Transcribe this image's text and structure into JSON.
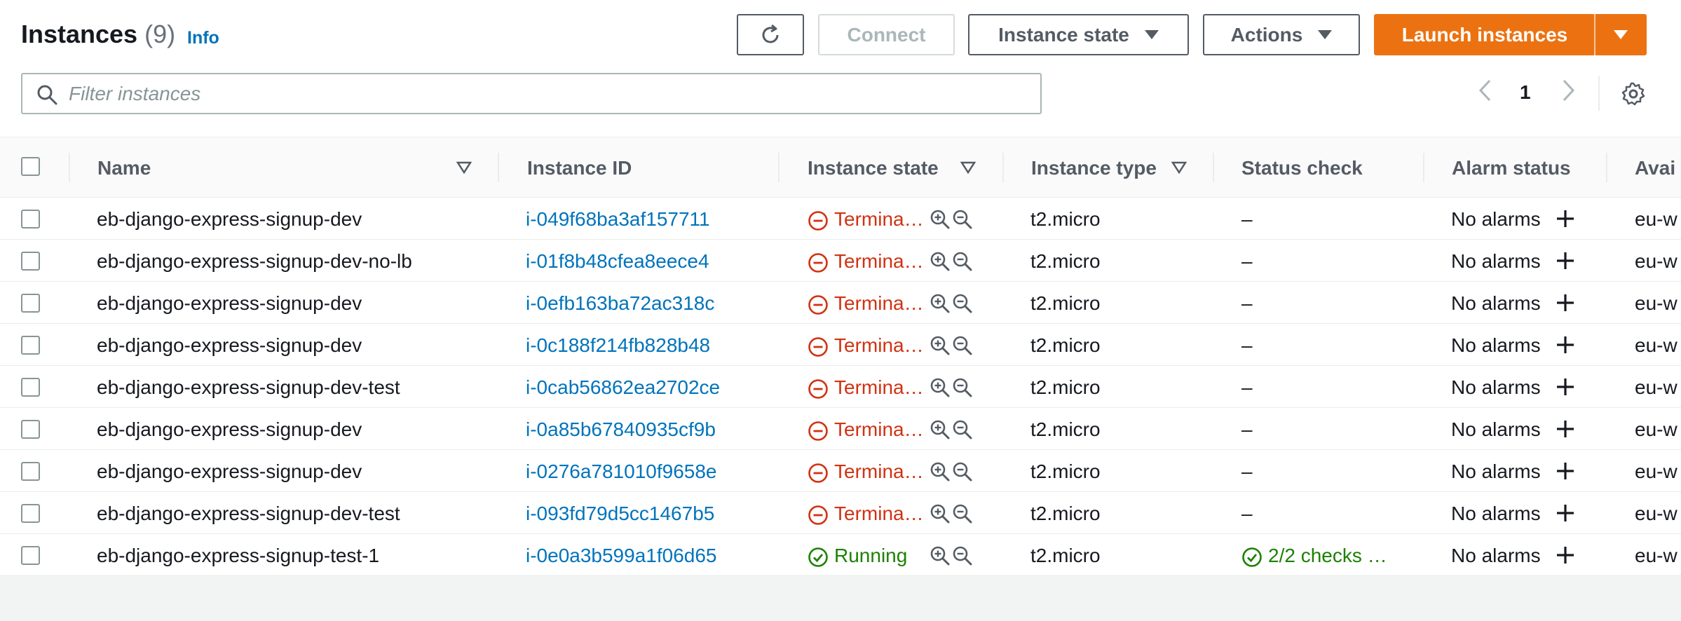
{
  "header": {
    "title": "Instances",
    "count": "(9)",
    "info": "Info",
    "connect_label": "Connect",
    "instance_state_label": "Instance state",
    "actions_label": "Actions",
    "launch_label": "Launch instances"
  },
  "search": {
    "placeholder": "Filter instances"
  },
  "pagination": {
    "page": "1"
  },
  "table": {
    "columns": [
      "Name",
      "Instance ID",
      "Instance state",
      "Instance type",
      "Status check",
      "Alarm status",
      "Avai"
    ],
    "rows": [
      {
        "name": "eb-django-express-signup-dev",
        "id": "i-049f68ba3af157711",
        "state": "Termina…",
        "type": "t2.micro",
        "status": "–",
        "alarm": "No alarms",
        "az": "eu-w"
      },
      {
        "name": "eb-django-express-signup-dev-no-lb",
        "id": "i-01f8b48cfea8eece4",
        "state": "Termina…",
        "type": "t2.micro",
        "status": "–",
        "alarm": "No alarms",
        "az": "eu-w"
      },
      {
        "name": "eb-django-express-signup-dev",
        "id": "i-0efb163ba72ac318c",
        "state": "Termina…",
        "type": "t2.micro",
        "status": "–",
        "alarm": "No alarms",
        "az": "eu-w"
      },
      {
        "name": "eb-django-express-signup-dev",
        "id": "i-0c188f214fb828b48",
        "state": "Termina…",
        "type": "t2.micro",
        "status": "–",
        "alarm": "No alarms",
        "az": "eu-w"
      },
      {
        "name": "eb-django-express-signup-dev-test",
        "id": "i-0cab56862ea2702ce",
        "state": "Termina…",
        "type": "t2.micro",
        "status": "–",
        "alarm": "No alarms",
        "az": "eu-w"
      },
      {
        "name": "eb-django-express-signup-dev",
        "id": "i-0a85b67840935cf9b",
        "state": "Termina…",
        "type": "t2.micro",
        "status": "–",
        "alarm": "No alarms",
        "az": "eu-w"
      },
      {
        "name": "eb-django-express-signup-dev",
        "id": "i-0276a781010f9658e",
        "state": "Termina…",
        "type": "t2.micro",
        "status": "–",
        "alarm": "No alarms",
        "az": "eu-w"
      },
      {
        "name": "eb-django-express-signup-dev-test",
        "id": "i-093fd79d5cc1467b5",
        "state": "Termina…",
        "type": "t2.micro",
        "status": "–",
        "alarm": "No alarms",
        "az": "eu-w"
      },
      {
        "name": "eb-django-express-signup-test-1",
        "id": "i-0e0a3b599a1f06d65",
        "state": "Running",
        "type": "t2.micro",
        "status": "2/2 checks …",
        "alarm": "No alarms",
        "az": "eu-w"
      }
    ]
  },
  "colors": {
    "primary": "#ec7211",
    "link": "#0073bb",
    "terminated": "#d13212",
    "running": "#1d8102"
  },
  "icons": [
    "refresh-icon",
    "caret-down-icon",
    "search-icon",
    "chevron-left-icon",
    "chevron-right-icon",
    "settings-gear-icon",
    "filter-sort-icon",
    "terminated-icon",
    "running-check-icon",
    "zoom-in-icon",
    "zoom-out-icon",
    "add-alarm-icon"
  ]
}
